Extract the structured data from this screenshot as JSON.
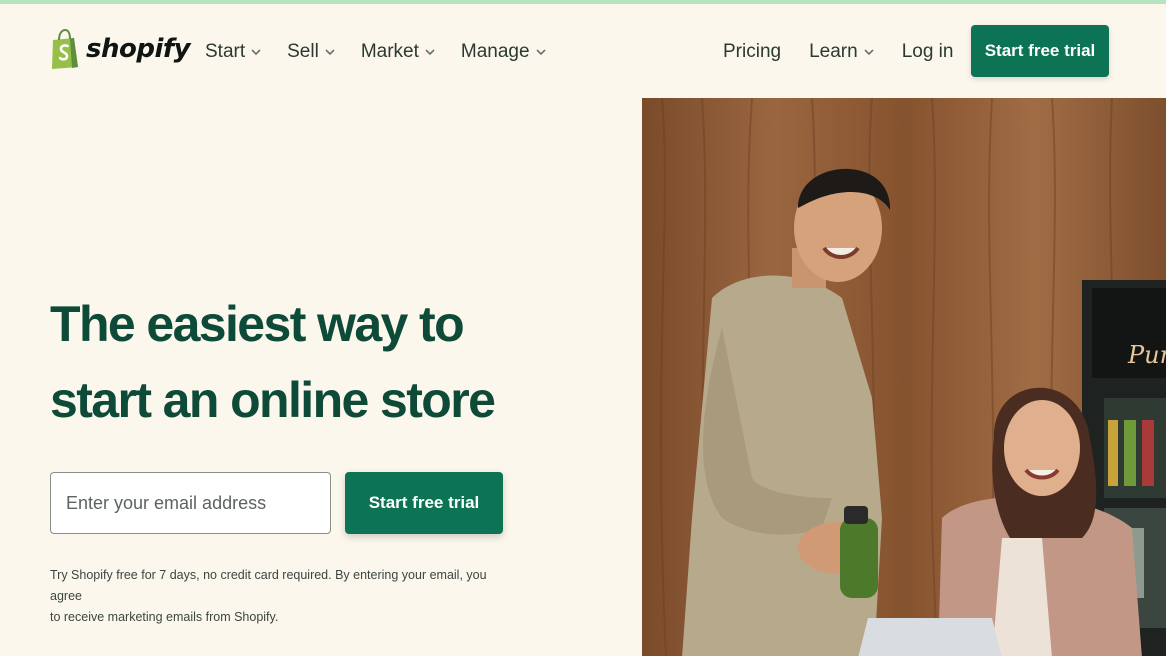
{
  "brand": {
    "name": "shopify",
    "logo_icon": "shopping-bag-icon",
    "green": "#0c7454",
    "dark_green": "#0e4a38",
    "background": "#fbf7ed",
    "accent_strip": "#b7e3c0"
  },
  "nav": {
    "left": [
      {
        "label": "Start",
        "icon": "chevron-down-icon"
      },
      {
        "label": "Sell",
        "icon": "chevron-down-icon"
      },
      {
        "label": "Market",
        "icon": "chevron-down-icon"
      },
      {
        "label": "Manage",
        "icon": "chevron-down-icon"
      }
    ],
    "right": [
      {
        "label": "Pricing"
      },
      {
        "label": "Learn",
        "icon": "chevron-down-icon"
      },
      {
        "label": "Log in"
      }
    ],
    "cta_label": "Start free trial"
  },
  "hero": {
    "headline_line1": "The easiest way to",
    "headline_line2": "start an online store",
    "email_placeholder": "Enter your email address",
    "email_value": "",
    "cta_label": "Start free trial",
    "disclaimer_line1": "Try Shopify free for 7 days, no credit card required. By entering your email, you agree",
    "disclaimer_line2": "to receive marketing emails from Shopify."
  },
  "photo": {
    "sign_text": "Pure"
  }
}
